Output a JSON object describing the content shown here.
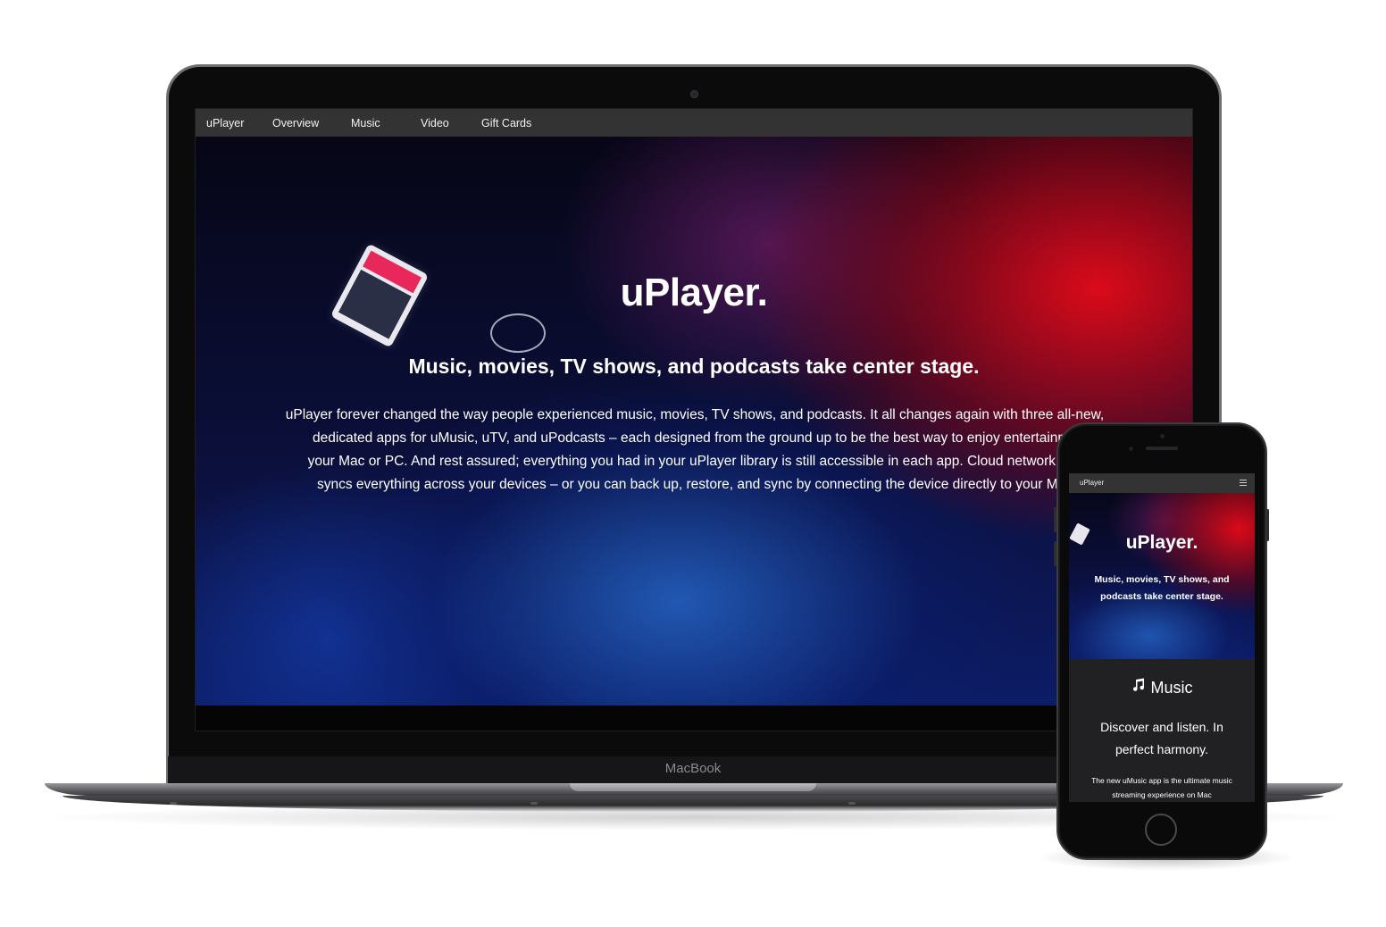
{
  "laptop": {
    "brand_label": "MacBook",
    "nav": {
      "brand": "uPlayer",
      "items": [
        {
          "label": "Overview"
        },
        {
          "label": "Music"
        },
        {
          "label": "Video"
        },
        {
          "label": "Gift Cards"
        }
      ]
    },
    "hero": {
      "title": "uPlayer.",
      "subtitle": "Music, movies, TV shows, and podcasts take center stage.",
      "body_lines": [
        "uPlayer forever changed the way people experienced music, movies, TV shows, and podcasts. It all changes again with three all-new,",
        "dedicated apps for uMusic, uTV, and uPodcasts – each designed from the ground up to be the best way to enjoy entertainme",
        "your Mac or PC. And rest assured; everything you had in your uPlayer library is still accessible in each app. Cloud network sea",
        "syncs everything across your devices – or you can back up, restore, and sync by connecting the device directly to your Mac"
      ]
    }
  },
  "phone": {
    "nav": {
      "brand": "uPlayer",
      "menu_icon": "hamburger-menu-icon"
    },
    "hero": {
      "title": "uPlayer.",
      "subtitle": "Music, movies, TV shows, and podcasts take center stage."
    },
    "music": {
      "icon": "music-note-icon",
      "heading": "Music",
      "tagline": "Discover and listen. In perfect harmony.",
      "description": "The new uMusic app is the ultimate music streaming experience on Mac"
    }
  },
  "colors": {
    "nav_background": "#333334",
    "hero_red": "#e60a19",
    "hero_blue": "#0c1c66",
    "page_background": "#ffffff"
  }
}
